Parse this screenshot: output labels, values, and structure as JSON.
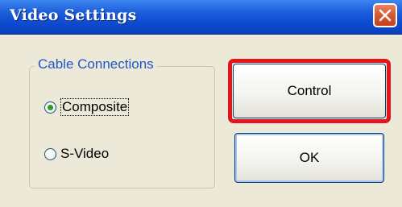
{
  "window": {
    "title": "Video Settings",
    "close_icon": "close-icon"
  },
  "group": {
    "legend": "Cable Connections",
    "options": [
      {
        "label": "Composite",
        "checked": true,
        "focused": true
      },
      {
        "label": "S-Video",
        "checked": false,
        "focused": false
      }
    ]
  },
  "buttons": {
    "control_label": "Control",
    "ok_label": "OK",
    "highlight_color": "#e2151b"
  },
  "colors": {
    "titlebar": "#0f4cd1",
    "dialog_bg": "#ece9d8",
    "legend_text": "#2055c8",
    "radio_dot": "#2f9a2a"
  }
}
